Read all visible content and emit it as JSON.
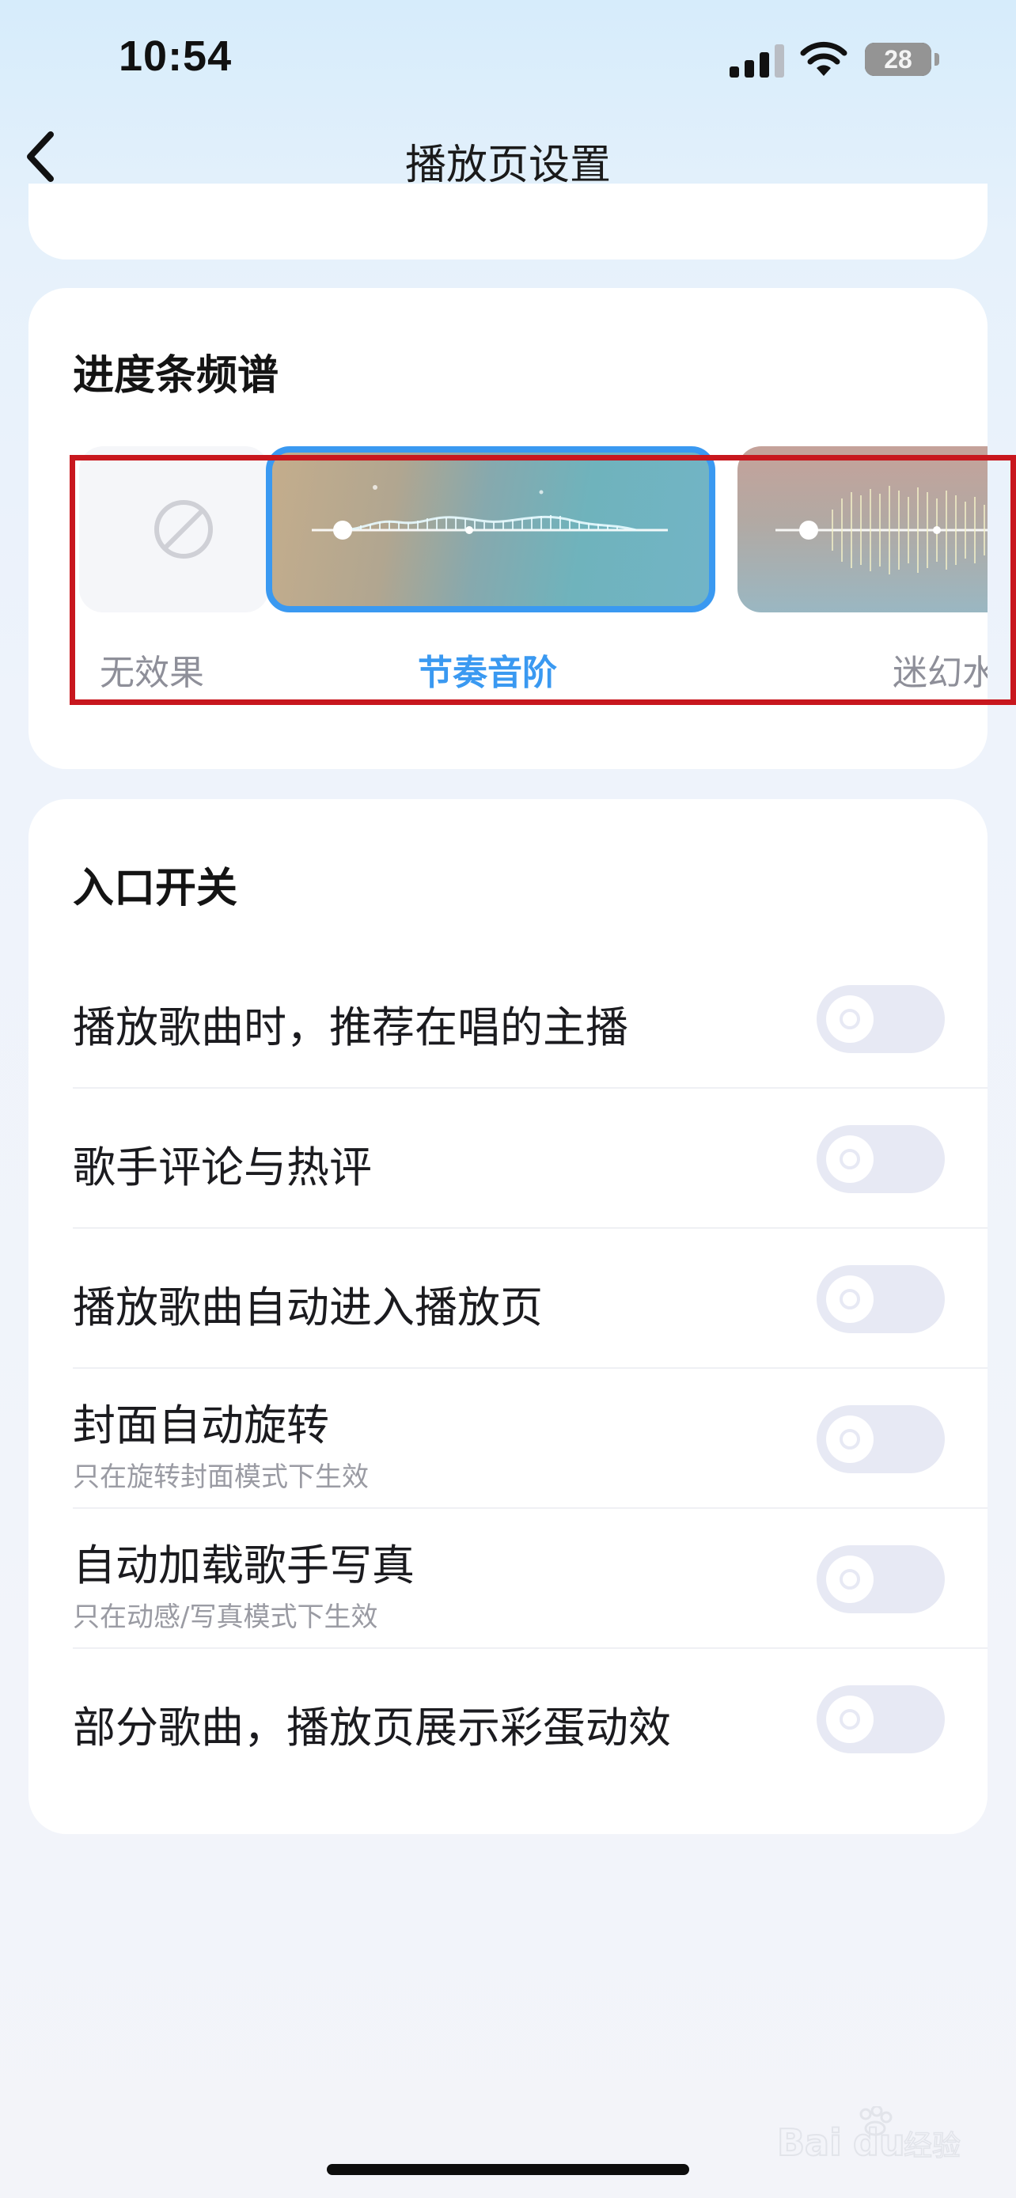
{
  "status_bar": {
    "time": "10:54",
    "battery_level": "28",
    "signal_icon": "cellular-signal-icon",
    "wifi_icon": "wifi-icon"
  },
  "nav": {
    "title": "播放页设置",
    "back_icon": "chevron-left-icon"
  },
  "spectrum": {
    "title": "进度条频谱",
    "selected": "节奏音阶",
    "options": [
      {
        "label": "无效果",
        "icon": "prohibited-icon"
      },
      {
        "label": "节奏音阶"
      },
      {
        "label": "迷幻水"
      }
    ],
    "accent_color": "#3a99f1",
    "annotation_color": "#c8171e"
  },
  "entry_switches": {
    "title": "入口开关",
    "items": [
      {
        "label": "播放歌曲时，推荐在唱的主播",
        "sub": "",
        "on": false
      },
      {
        "label": "歌手评论与热评",
        "sub": "",
        "on": false
      },
      {
        "label": "播放歌曲自动进入播放页",
        "sub": "",
        "on": false
      },
      {
        "label": "封面自动旋转",
        "sub": "只在旋转封面模式下生效",
        "on": false
      },
      {
        "label": "自动加载歌手写真",
        "sub": "只在动感/写真模式下生效",
        "on": false
      },
      {
        "label": "部分歌曲，播放页展示彩蛋动效",
        "sub": "",
        "on": false
      }
    ]
  },
  "watermark": {
    "text": "Baidu经验"
  }
}
